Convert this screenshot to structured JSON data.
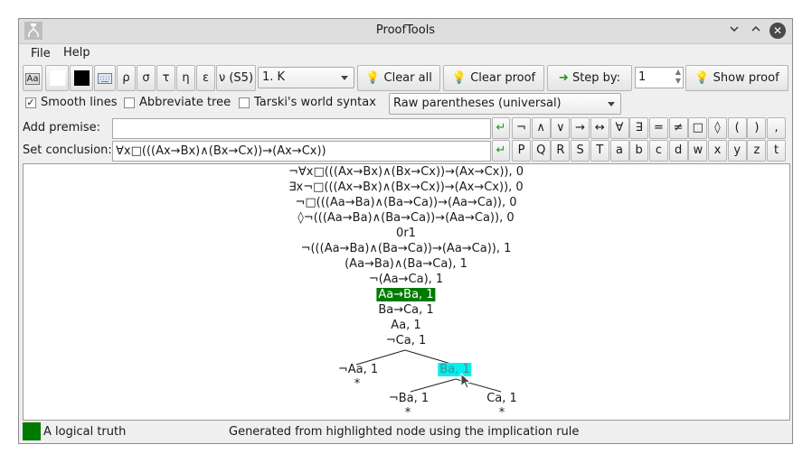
{
  "window": {
    "title": "ProofTools"
  },
  "menu": {
    "file": "File",
    "help": "Help"
  },
  "toolbar": {
    "font_icon_label": "Aa",
    "greek": [
      "ρ",
      "σ",
      "τ",
      "η",
      "ε",
      "ν (S5)"
    ],
    "logic_select": "1. K",
    "clear_all": "Clear all",
    "clear_proof": "Clear proof",
    "step_by_label": "Step by:",
    "step_by_value": "1",
    "show_proof": "Show proof"
  },
  "options": {
    "smooth_lines": "Smooth lines",
    "smooth_lines_checked": "✓",
    "abbreviate_tree": "Abbreviate tree",
    "tarski": "Tarski's world syntax",
    "parentheses_select": "Raw parentheses (universal)"
  },
  "premise": {
    "label": "Add premise:",
    "value": ""
  },
  "conclusion": {
    "label": "Set conclusion:",
    "value": "∀x□(((Ax→Bx)∧(Bx→Cx))→(Ax→Cx))"
  },
  "enter_symbol": "↵",
  "symbols_row1": [
    "¬",
    "∧",
    "∨",
    "→",
    "↔",
    "∀",
    "∃",
    "=",
    "≠",
    "□",
    "◊",
    "(",
    ")",
    ","
  ],
  "symbols_row2": [
    "P",
    "Q",
    "R",
    "S",
    "T",
    "a",
    "b",
    "c",
    "d",
    "w",
    "x",
    "y",
    "z",
    "t"
  ],
  "tree": {
    "trunk": [
      "¬∀x□(((Ax→Bx)∧(Bx→Cx))→(Ax→Cx)), 0",
      "∃x¬□(((Ax→Bx)∧(Bx→Cx))→(Ax→Cx)), 0",
      "¬□(((Aa→Ba)∧(Ba→Ca))→(Aa→Ca)), 0",
      "◊¬(((Aa→Ba)∧(Ba→Ca))→(Aa→Ca)), 0",
      "0r1",
      "¬(((Aa→Ba)∧(Ba→Ca))→(Aa→Ca)), 1",
      "(Aa→Ba)∧(Ba→Ca), 1",
      "¬(Aa→Ca), 1",
      "Aa→Ba, 1",
      "Ba→Ca, 1",
      "Aa, 1",
      "¬Ca, 1"
    ],
    "left_branch": "¬Aa, 1",
    "right_branch": "Ba, 1",
    "sub_left": "¬Ba, 1",
    "sub_right": "Ca, 1",
    "closed_mark": "*"
  },
  "status": {
    "legend": "A logical truth",
    "message": "Generated from highlighted node using the implication rule"
  },
  "colors": {
    "highlight_green": "#007a00",
    "highlight_cyan": "#00f0f0"
  }
}
